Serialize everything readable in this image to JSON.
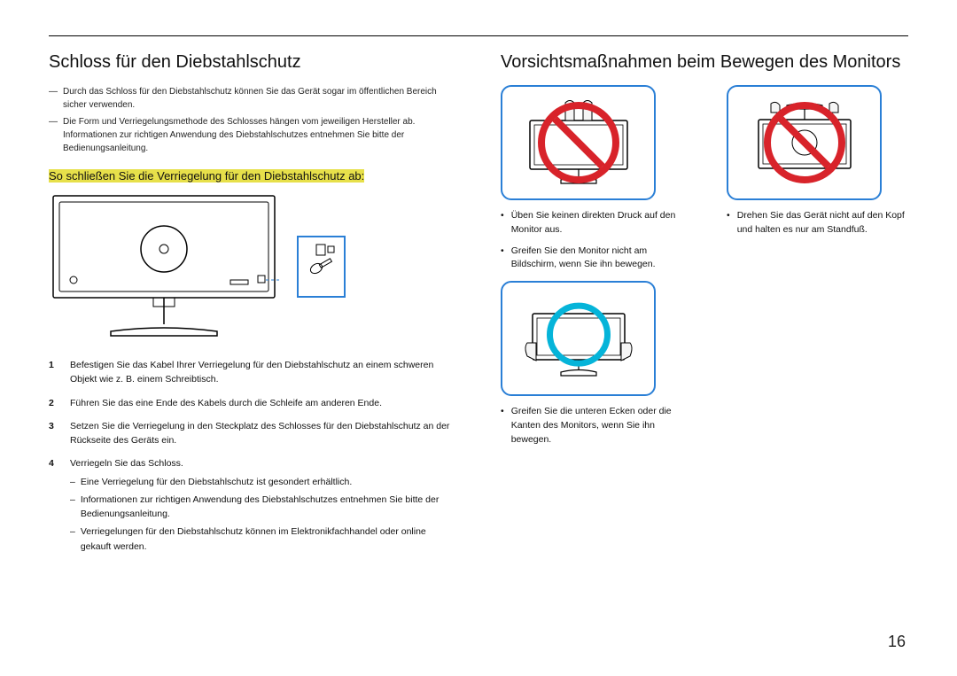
{
  "left": {
    "heading": "Schloss für den Diebstahlschutz",
    "note1": "Durch das Schloss für den Diebstahlschutz können Sie das Gerät sogar im öffentlichen Bereich sicher verwenden.",
    "note2": "Die Form und Verriegelungsmethode des Schlosses hängen vom jeweiligen Hersteller ab. Informationen zur richtigen Anwendung des Diebstahlschutzes entnehmen Sie bitte der Bedienungsanleitung.",
    "subheading": "So schließen Sie die Verriegelung für den Diebstahlschutz ab:",
    "steps": {
      "s1n": "1",
      "s1": "Befestigen Sie das Kabel Ihrer Verriegelung für den Diebstahlschutz an einem schweren Objekt wie z. B. einem Schreibtisch.",
      "s2n": "2",
      "s2": "Führen Sie das eine Ende des Kabels durch die Schleife am anderen Ende.",
      "s3n": "3",
      "s3": "Setzen Sie die Verriegelung in den Steckplatz des Schlosses für den Diebstahlschutz an der Rückseite des Geräts ein.",
      "s4n": "4",
      "s4": "Verriegeln Sie das Schloss.",
      "s4a": "Eine Verriegelung für den Diebstahlschutz ist gesondert erhältlich.",
      "s4b": "Informationen zur richtigen Anwendung des Diebstahlschutzes entnehmen Sie bitte der Bedienungsanleitung.",
      "s4c": "Verriegelungen für den Diebstahlschutz können im Elektronikfachhandel oder online gekauft werden."
    }
  },
  "right": {
    "heading": "Vorsichtsmaßnahmen beim Bewegen des Monitors",
    "b1": "Üben Sie keinen direkten Druck auf den Monitor aus.",
    "b2": "Greifen Sie den Monitor nicht am Bildschirm, wenn Sie ihn bewegen.",
    "b3": "Drehen Sie das Gerät nicht auf den Kopf und halten es nur am Standfuß.",
    "b4": "Greifen Sie die unteren Ecken oder die Kanten des Monitors, wenn Sie ihn bewegen."
  },
  "pageNumber": "16"
}
